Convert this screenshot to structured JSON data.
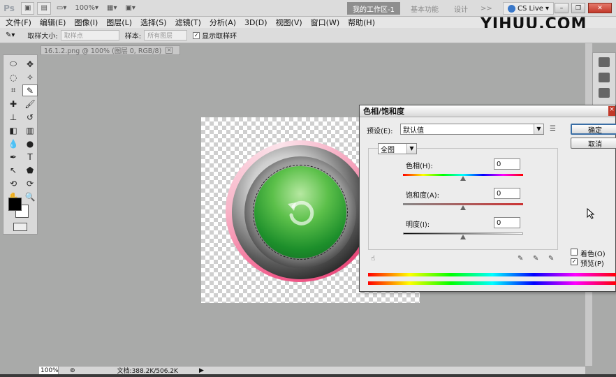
{
  "appbar": {
    "logo": "Ps",
    "zoom": "100%",
    "workspace_active": "我的工作区-1",
    "workspace_basic": "基本功能",
    "workspace_design": "设计",
    "more": ">>",
    "cslive": "CS Live"
  },
  "menubar": {
    "items": [
      "文件(F)",
      "编辑(E)",
      "图像(I)",
      "图层(L)",
      "选择(S)",
      "滤镜(T)",
      "分析(A)",
      "3D(D)",
      "视图(V)",
      "窗口(W)",
      "帮助(H)"
    ]
  },
  "watermark": "YIHUU.COM",
  "optbar": {
    "sample_size_label": "取样大小:",
    "sample_size_value": "取样点",
    "sample_label": "样本:",
    "sample_value": "所有图层",
    "show_ring_label": "显示取样环"
  },
  "document": {
    "tab_title": "16.1.2.png @ 100% (图层 0, RGB/8)",
    "tab_close": "×"
  },
  "status": {
    "zoom": "100%",
    "docinfo": "文档:388.2K/506.2K"
  },
  "dialog": {
    "title": "色相/饱和度",
    "close": "×",
    "preset_label": "预设(E):",
    "preset_value": "默认值",
    "channel_value": "全图",
    "ok_label": "确定",
    "cancel_label": "取消",
    "hue_label": "色相(H):",
    "hue_value": "0",
    "saturation_label": "饱和度(A):",
    "saturation_value": "0",
    "lightness_label": "明度(I):",
    "lightness_value": "0",
    "colorize_label": "着色(O)",
    "colorize_checked": false,
    "preview_label": "预览(P)",
    "preview_checked": true
  }
}
